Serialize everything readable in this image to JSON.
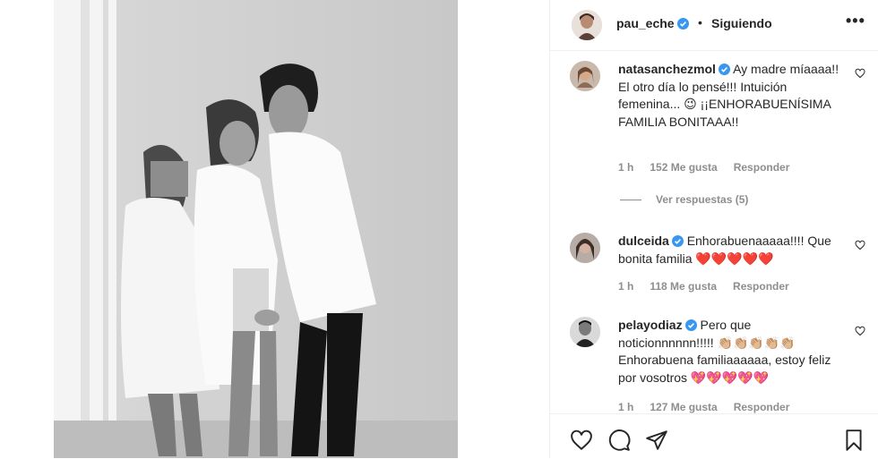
{
  "header": {
    "username": "pau_eche",
    "separator": "•",
    "following_label": "Siguiendo",
    "more_label": "•••"
  },
  "comments": [
    {
      "username": "natasanchezmol",
      "text": "Ay madre míaaaa!! El otro día lo pensé!!! Intuición femenina... 😉 ¡¡ENHORABUENÍSIMA FAMILIA BONITAAA!!",
      "time": "1 h",
      "likes": "152 Me gusta",
      "reply": "Responder",
      "view_replies": "Ver respuestas (5)"
    },
    {
      "username": "dulceida",
      "text": "Enhorabuenaaaaa!!!! Que bonita familia ❤️❤️❤️❤️❤️",
      "time": "1 h",
      "likes": "118 Me gusta",
      "reply": "Responder"
    },
    {
      "username": "pelayodiaz",
      "text": "Pero que noticionnnnnn!!!!! 👏🏼👏🏼👏🏼👏🏼👏🏼 Enhorabuena familiaaaaaa, estoy feliz por vosotros 💖💖💖💖💖",
      "time": "1 h",
      "likes": "127 Me gusta",
      "reply": "Responder"
    }
  ],
  "icons": {
    "like": "heart-icon",
    "comment": "comment-icon",
    "share": "paper-plane-icon",
    "save": "bookmark-icon",
    "verified": "verified-badge-icon"
  },
  "colors": {
    "verified": "#3897f0",
    "text": "#262626",
    "meta": "#8e8e8e",
    "border": "#efefef"
  }
}
